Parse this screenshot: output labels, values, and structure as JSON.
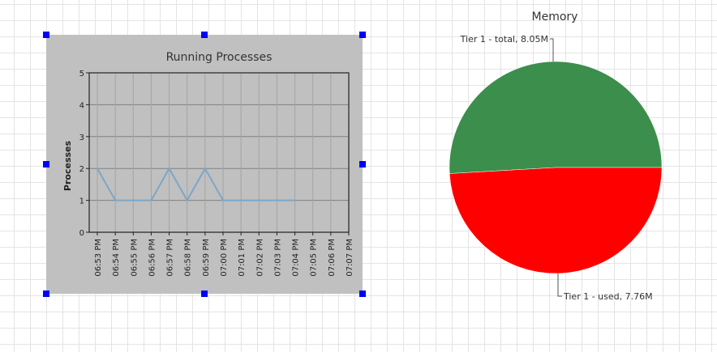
{
  "chart_data": [
    {
      "type": "line",
      "title": "Running Processes",
      "ylabel": "Processes",
      "xlabel": "",
      "ylim": [
        0,
        5
      ],
      "yticks": [
        "0",
        "1",
        "2",
        "3",
        "4",
        "5"
      ],
      "grid": true,
      "background": "#c0c0c0",
      "categories": [
        "06:53 PM",
        "06:54 PM",
        "06:55 PM",
        "06:56 PM",
        "06:57 PM",
        "06:58 PM",
        "06:59 PM",
        "07:00 PM",
        "07:01 PM",
        "07:02 PM",
        "07:03 PM",
        "07:04 PM",
        "07:05 PM",
        "07:06 PM",
        "07:07 PM"
      ],
      "series": [
        {
          "color": "#7ba6c9",
          "values": [
            2,
            1,
            1,
            1,
            2,
            1,
            2,
            1,
            1,
            1,
            1,
            1
          ]
        }
      ]
    },
    {
      "type": "pie",
      "title": "Memory",
      "slices": [
        {
          "label": "Tier 1 - total, 8.05M",
          "value": 8.05,
          "color": "#3b8e4b"
        },
        {
          "label": "Tier 1 - used, 7.76M",
          "value": 7.76,
          "color": "#ff0000"
        }
      ]
    }
  ],
  "colors": {
    "selection_handle": "#0000ff"
  }
}
